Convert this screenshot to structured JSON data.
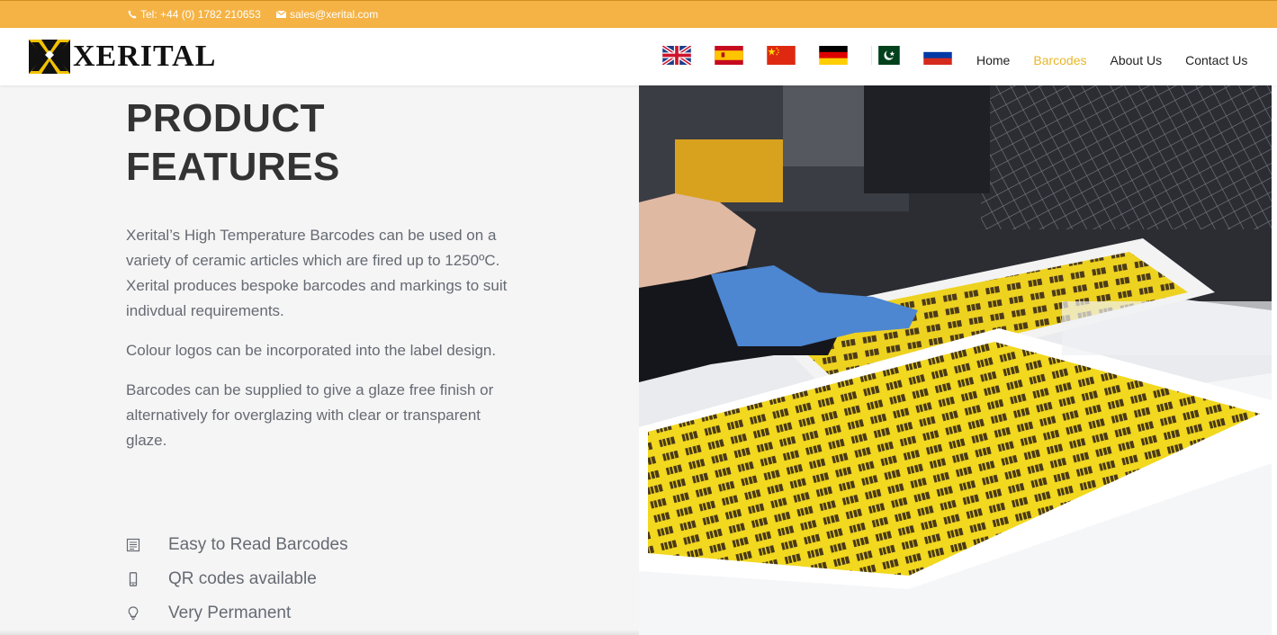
{
  "topbar": {
    "phone": "Tel: +44 (0) 1782 210653",
    "email": "sales@xerital.com"
  },
  "header": {
    "logo_text": "XERITAL",
    "flags": [
      {
        "name": "english",
        "icon": "uk-flag-icon"
      },
      {
        "name": "spanish",
        "icon": "spain-flag-icon"
      },
      {
        "name": "chinese",
        "icon": "china-flag-icon"
      },
      {
        "name": "german",
        "icon": "germany-flag-icon"
      },
      {
        "name": "urdu",
        "icon": "pakistan-flag-icon"
      },
      {
        "name": "russian",
        "icon": "russia-flag-icon"
      }
    ],
    "nav": {
      "home": "Home",
      "barcodes": "Barcodes",
      "about": "About Us",
      "contact": "Contact Us"
    },
    "active_nav": "Barcodes"
  },
  "main": {
    "title_line1": "PRODUCT",
    "title_line2": "FEATURES",
    "paragraphs": [
      "Xerital’s High Temperature Barcodes can be used on a variety of ceramic articles which are fired up to 1250ºC. Xerital produces bespoke barcodes and markings to suit indivdual requirements.",
      "Colour logos can be incorporated into the label design.",
      "Barcodes can be supplied to give a glaze free finish or alternatively for overglazing with clear or transparent glaze."
    ],
    "features": [
      {
        "icon": "document-icon",
        "text": "Easy to Read Barcodes"
      },
      {
        "icon": "mobile-phone-icon",
        "text": "QR codes available"
      },
      {
        "icon": "lightbulb-icon",
        "text": "Very Permanent"
      }
    ]
  },
  "colors": {
    "topbar": "#f5b345",
    "active_nav": "#e8b62a",
    "title": "#333333",
    "body_text": "#666a73",
    "panel_bg": "#f5f5f5"
  }
}
